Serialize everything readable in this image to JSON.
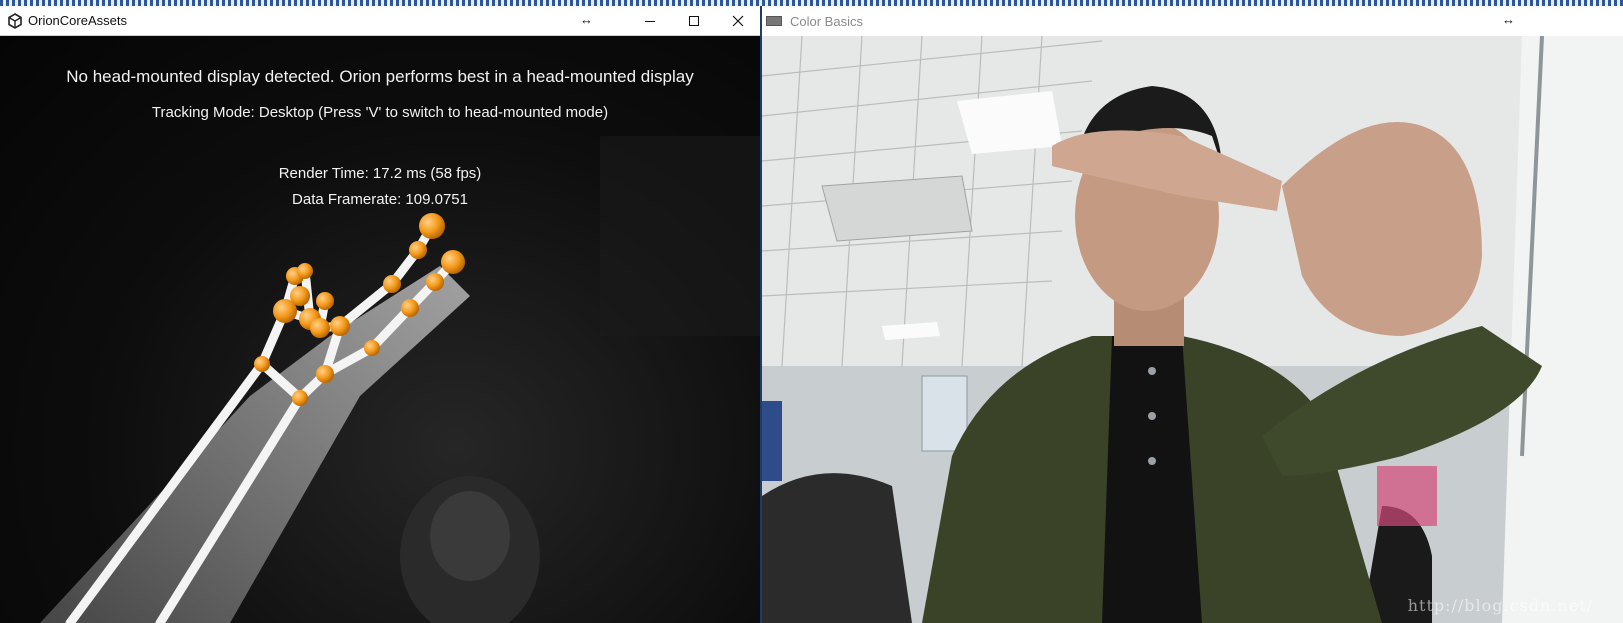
{
  "left_window": {
    "title": "OrionCoreAssets",
    "app_icon": "unity-logo-icon",
    "resize_glyph": "↔",
    "controls": {
      "minimize": "minimize-icon",
      "maximize": "maximize-icon",
      "close": "close-icon"
    },
    "hud": {
      "warning": "No head-mounted display detected. Orion performs best in a head-mounted display",
      "tracking_mode": "Tracking Mode: Desktop (Press 'V' to switch to head-mounted mode)",
      "render_time": "Render Time: 17.2 ms (58 fps)",
      "data_framerate": "Data Framerate: 109.0751"
    },
    "colors": {
      "joint": "#f59a1b",
      "bone": "#ffffff",
      "background": "#000000"
    }
  },
  "right_window": {
    "title": "Color Basics",
    "app_icon": "keyboard-icon",
    "resize_glyph": "↔",
    "watermark": "http://blog.csdn.net/"
  }
}
